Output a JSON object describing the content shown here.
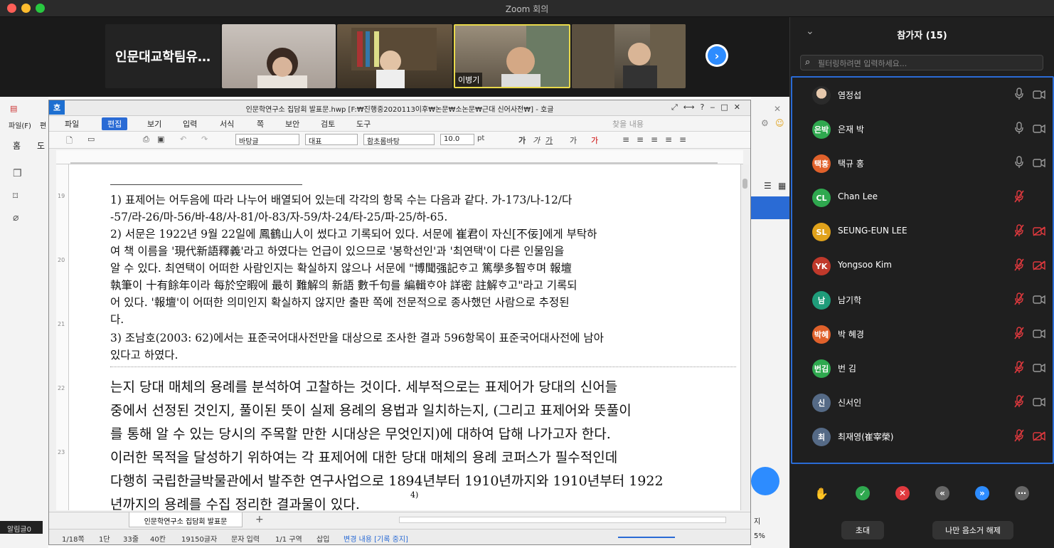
{
  "window": {
    "title": "Zoom 회의"
  },
  "gallery": {
    "text_tile": "인문대교학팀유…",
    "named_tile": "이병기"
  },
  "panel": {
    "title": "참가자 (15)",
    "search_placeholder": "필터링하려면 입력하세요...",
    "participants": [
      {
        "initials": "",
        "name": "염정섭",
        "color": "#8a6b4e",
        "mic": "on",
        "cam": "on"
      },
      {
        "initials": "은박",
        "name": "은재 박",
        "color": "#2fa84f",
        "mic": "on",
        "cam": "on"
      },
      {
        "initials": "택홍",
        "name": "택규 홍",
        "color": "#e0612b",
        "mic": "on",
        "cam": "on"
      },
      {
        "initials": "CL",
        "name": "Chan Lee",
        "color": "#2fa84f",
        "mic": "muted",
        "cam": "none"
      },
      {
        "initials": "SL",
        "name": "SEUNG-EUN LEE",
        "color": "#e0a21b",
        "mic": "muted",
        "cam": "off"
      },
      {
        "initials": "YK",
        "name": "Yongsoo Kim",
        "color": "#c0392b",
        "mic": "muted",
        "cam": "off"
      },
      {
        "initials": "남",
        "name": "남기학",
        "color": "#1f9c7a",
        "mic": "muted",
        "cam": "on"
      },
      {
        "initials": "박혜",
        "name": "박 혜경",
        "color": "#e0612b",
        "mic": "muted",
        "cam": "on"
      },
      {
        "initials": "번김",
        "name": "번 김",
        "color": "#2fa84f",
        "mic": "muted",
        "cam": "on"
      },
      {
        "initials": "신",
        "name": "신서인",
        "color": "#556a86",
        "mic": "muted",
        "cam": "on"
      },
      {
        "initials": "최",
        "name": "최재영(崔宰榮)",
        "color": "#556a86",
        "mic": "muted",
        "cam": "off"
      }
    ],
    "invite_label": "초대",
    "unmute_label": "나만 음소거 해제"
  },
  "background_app": {
    "menu_file": "파일(F)",
    "menu_edit": "편",
    "tab_home": "홈",
    "tab_other": "도"
  },
  "hwp": {
    "title": "인문학연구소 집담회 발표문.hwp [F:₩진행중2020113이후₩논문₩소논문₩근대 신어사전₩] - 호글",
    "menus": [
      "파일",
      "편집",
      "보기",
      "입력",
      "서식",
      "쪽",
      "보안",
      "검토",
      "도구"
    ],
    "search_placeholder": "찾을 내용",
    "style_box": "바탕글",
    "rep_box": "대표",
    "font_box": "함초롬바탕",
    "size_box": "10.0",
    "size_unit": "pt",
    "footnotes": [
      "1)  표제어는  어두음에  따라  나누어  배열되어  있는데  각각의  항목  수는  다음과  같다.  가-173/나-12/다",
      "     -57/라-26/마-56/바-48/사-81/아-83/자-59/차-24/타-25/파-25/하-65.",
      "2)  서문은  1922년  9월  22일에  鳳鶴山人이  썼다고  기록되어  있다.  서문에  崔君이  자신[不佞]에게  부탁하",
      "     여  책  이름을  '現代新語釋義'라고  하였다는  언급이  있으므로  '봉학선인'과  '최연택'이  다른  인물임을",
      "     알  수  있다.  최연택이  어떠한  사람인지는  확실하지  않으나  서문에  \"博聞强記ᄒᆞ고  篤學多智ᄒᆞ며  報壇",
      "     執筆이  十有餘年이라  每於空暇에  最히  難解의  新語  數千句를  編輯ᄒᆞ야  詳密  註解ᄒᆞ고\"라고  기록되",
      "     어  있다.  '報壇'이  어떠한  의미인지  확실하지  않지만  출판  쪽에  전문적으로  종사했던  사람으로  추정된",
      "     다.",
      "3)  조남호(2003:  62)에서는  표준국어대사전만을  대상으로  조사한  결과  596항목이  표준국어대사전에  남아",
      "     있다고  하였다."
    ],
    "body": [
      "는지  당대  매체의  용례를  분석하여  고찰하는  것이다.  세부적으로는  표제어가  당대의  신어들",
      "중에서  선정된  것인지,  풀이된  뜻이  실제  용례의  용법과  일치하는지,  (그리고  표제어와  뜻풀이",
      "를  통해  알  수  있는  당시의  주목할  만한  시대상은  무엇인지)에  대하여  답해  나가고자  한다.",
      "   이러한  목적을  달성하기  위하여는  각  표제어에  대한  당대  매체의  용례  코퍼스가  필수적인데",
      "다행히  국립한글박물관에서  발주한  연구사업으로  1894년부터  1910년까지와  1910년부터  1922",
      "년까지의  용례를  수집  정리한  결과물이  있다."
    ],
    "footnote_ref": "4)",
    "ruler_left_numbers": [
      "19",
      "20",
      "21",
      "22",
      "23"
    ],
    "sheet_tab": "인문학연구소 집담회 발표문",
    "status": {
      "page": "1/18쪽",
      "section": "1단",
      "line": "33줄",
      "col": "40칸",
      "chars": "19150글자",
      "mode": "문자 입력",
      "area": "1/1 구역",
      "insert": "삽입",
      "track": "변경 내용 [기록 중지]"
    }
  },
  "right_fragment": {
    "alert": "알림글0",
    "zoom_pct": "5%",
    "label_ji": "지"
  }
}
